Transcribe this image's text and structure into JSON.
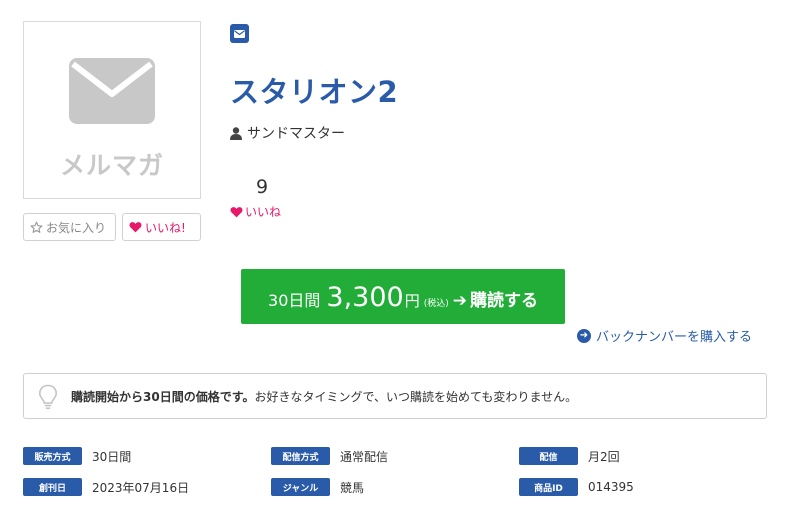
{
  "thumbnail": {
    "label": "メルマガ",
    "icon": "envelope-icon"
  },
  "buttons": {
    "favorite": "お気に入り",
    "like": "いいね!"
  },
  "magazine": {
    "title": "スタリオン2",
    "author": "サンドマスター"
  },
  "likes": {
    "count": "9",
    "label": "いいね"
  },
  "purchase": {
    "days": "30日間",
    "price": "3,300",
    "currency": "円",
    "tax": "(税込)",
    "arrow": "➔",
    "action": "購読する"
  },
  "backnumber": {
    "label": "バックナンバーを購入する"
  },
  "notice": {
    "bold": "購読開始から30日間の価格です。",
    "text": "お好きなタイミングで、いつ購読を始めても変わりません。"
  },
  "info": {
    "row1": [
      {
        "label": "販売方式",
        "value": "30日間"
      },
      {
        "label": "配信方式",
        "value": "通常配信"
      },
      {
        "label": "配信",
        "value": "月2回"
      }
    ],
    "row2": [
      {
        "label": "創刊日",
        "value": "2023年07月16日"
      },
      {
        "label": "ジャンル",
        "value": "競馬"
      },
      {
        "label": "商品ID",
        "value": "014395"
      }
    ]
  },
  "colors": {
    "accent": "#2a5ba8",
    "buy": "#21ad37",
    "like": "#e5186a"
  }
}
